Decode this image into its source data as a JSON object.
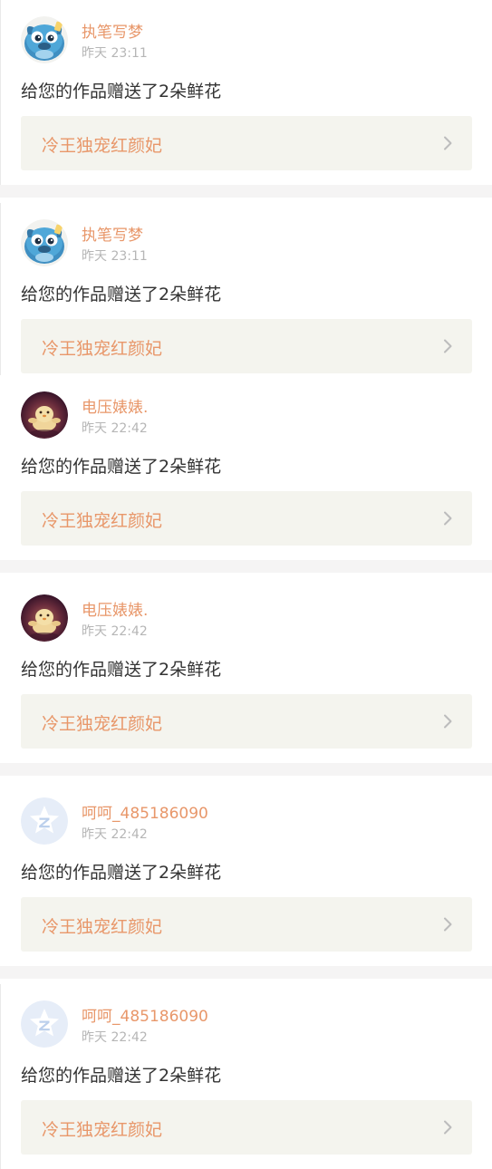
{
  "notifications": [
    {
      "avatar": "blue-bird-avatar",
      "username": "执笔写梦",
      "time": "昨天 23:11",
      "message": "给您的作品赠送了2朵鲜花",
      "work_title": "冷王独宠红颜妃"
    },
    {
      "avatar": "blue-bird-avatar",
      "username": "执笔写梦",
      "time": "昨天 23:11",
      "message": "给您的作品赠送了2朵鲜花",
      "work_title": "冷王独宠红颜妃"
    },
    {
      "avatar": "chick-toy-avatar",
      "username": "电压婊婊.",
      "time": "昨天 22:42",
      "message": "给您的作品赠送了2朵鲜花",
      "work_title": "冷王独宠红颜妃"
    },
    {
      "avatar": "chick-toy-avatar",
      "username": "电压婊婊.",
      "time": "昨天 22:42",
      "message": "给您的作品赠送了2朵鲜花",
      "work_title": "冷王独宠红颜妃"
    },
    {
      "avatar": "default-logo-avatar",
      "username": "呵呵_485186090",
      "time": "昨天 22:42",
      "message": "给您的作品赠送了2朵鲜花",
      "work_title": "冷王独宠红颜妃"
    },
    {
      "avatar": "default-logo-avatar",
      "username": "呵呵_485186090",
      "time": "昨天 22:42",
      "message": "给您的作品赠送了2朵鲜花",
      "work_title": "冷王独宠红颜妃"
    }
  ],
  "icons": {
    "chevron": "chevron-right-icon"
  },
  "colors": {
    "accent": "#e8976a",
    "timestamp": "#b6b6b6",
    "message_text": "#333333",
    "work_box_bg": "#f4f4ee",
    "separator": "#f5f4f4"
  }
}
